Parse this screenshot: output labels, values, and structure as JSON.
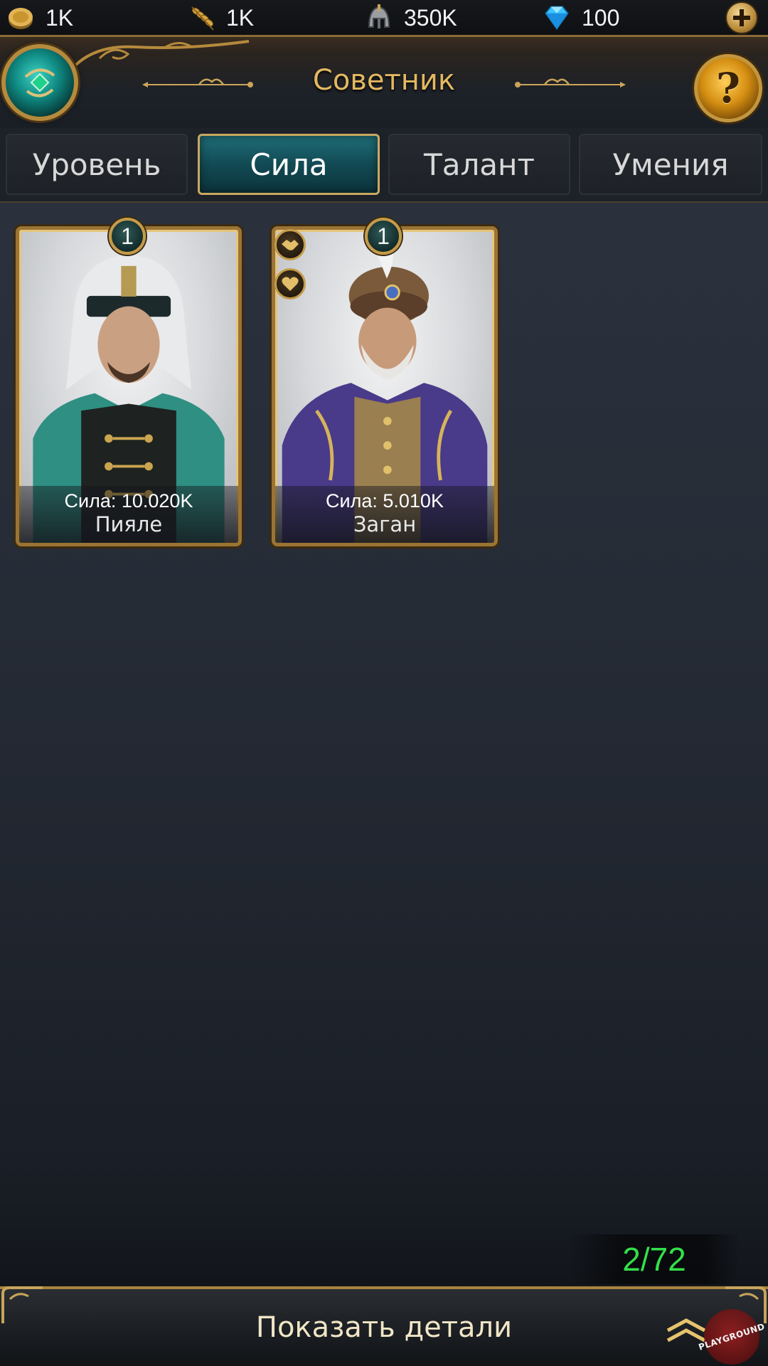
{
  "resources": {
    "coin": {
      "value": "1K",
      "icon": "coin-icon"
    },
    "grain": {
      "value": "1K",
      "icon": "grain-icon"
    },
    "helmet": {
      "value": "350K",
      "icon": "helmet-icon"
    },
    "gem": {
      "value": "100",
      "icon": "gem-icon"
    },
    "add_icon": "plus-icon"
  },
  "header": {
    "title": "Советник",
    "help_label": "?"
  },
  "tabs": [
    {
      "label": "Уровень",
      "active": false
    },
    {
      "label": "Сила",
      "active": true
    },
    {
      "label": "Талант",
      "active": false
    },
    {
      "label": "Умения",
      "active": false
    }
  ],
  "advisors": [
    {
      "level": "1",
      "power": "Сила: 10.020K",
      "name": "Пияле"
    },
    {
      "level": "1",
      "power": "Сила: 5.010K",
      "name": "Заган",
      "badges": [
        "handshake-icon",
        "heart-icon"
      ]
    }
  ],
  "counter": "2/72",
  "footer": {
    "details_label": "Показать детали",
    "watermark": "PLAYGROUND"
  },
  "colors": {
    "accent_gold": "#e3b861",
    "active_tab": "#1f6e78",
    "counter_green": "#33e04a"
  }
}
